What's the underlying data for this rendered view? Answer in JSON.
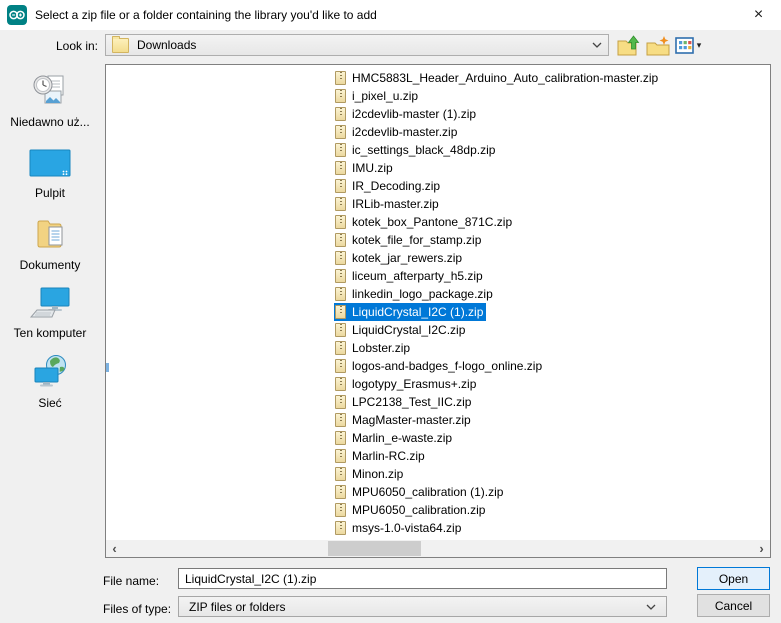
{
  "window": {
    "title": "Select a zip file or a folder containing the library you'd like to add",
    "app_icon": "arduino-icon",
    "close_glyph": "×"
  },
  "toolbar": {
    "look_in_label": "Look in:",
    "look_in_value": "Downloads",
    "icons": [
      "up-one-level-icon",
      "create-new-folder-icon",
      "view-menu-icon"
    ]
  },
  "sidebar": {
    "items": [
      {
        "label": "Niedawno uż...",
        "icon": "recent-items-icon"
      },
      {
        "label": "Pulpit",
        "icon": "desktop-icon"
      },
      {
        "label": "Dokumenty",
        "icon": "documents-icon"
      },
      {
        "label": "Ten komputer",
        "icon": "this-computer-icon"
      },
      {
        "label": "Sieć",
        "icon": "network-icon"
      }
    ]
  },
  "file_list": {
    "item_icon": "zip-file-icon",
    "selected_index": 13,
    "items": [
      "HMC5883L_Header_Arduino_Auto_calibration-master.zip",
      "i_pixel_u.zip",
      "i2cdevlib-master (1).zip",
      "i2cdevlib-master.zip",
      "ic_settings_black_48dp.zip",
      "IMU.zip",
      "IR_Decoding.zip",
      "IRLib-master.zip",
      "kotek_box_Pantone_871C.zip",
      "kotek_file_for_stamp.zip",
      "kotek_jar_rewers.zip",
      "liceum_afterparty_h5.zip",
      "linkedin_logo_package.zip",
      "LiquidCrystal_I2C (1).zip",
      "LiquidCrystal_I2C.zip",
      "Lobster.zip",
      "logos-and-badges_f-logo_online.zip",
      "logotypy_Erasmus+.zip",
      "LPC2138_Test_IIC.zip",
      "MagMaster-master.zip",
      "Marlin_e-waste.zip",
      "Marlin-RC.zip",
      "Minon.zip",
      "MPU6050_calibration (1).zip",
      "MPU6050_calibration.zip",
      "msys-1.0-vista64.zip"
    ],
    "h_scrollbar": {
      "left_arrow": "‹",
      "right_arrow": "›"
    }
  },
  "footer": {
    "file_name_label": "File name:",
    "file_name_value": "LiquidCrystal_I2C (1).zip",
    "files_of_type_label": "Files of type:",
    "files_of_type_value": "ZIP files or folders",
    "open_label": "Open",
    "cancel_label": "Cancel"
  },
  "colors": {
    "selection_blue": "#0078d7",
    "dialog_bg": "#f0f0f0",
    "titlebar_bg": "#ffffff",
    "arduino_teal": "#008184",
    "default_button_bg": "#e4f0fb",
    "default_button_border": "#0078d7",
    "button_bg": "#e1e1e1",
    "zip_icon_fill": "#ecd9a0"
  }
}
